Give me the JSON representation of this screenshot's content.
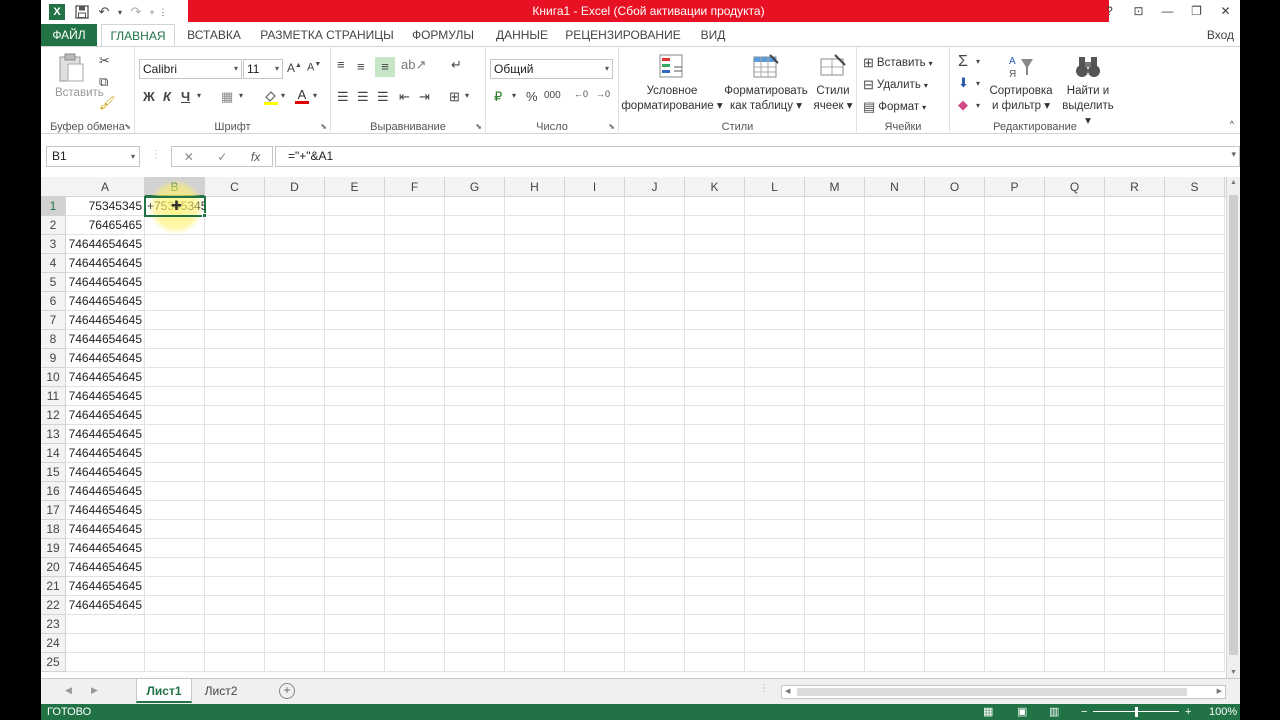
{
  "titlebar": {
    "title": "Книга1 -  Excel (Сбой активации продукта)",
    "help": "?",
    "ribbon_display": "⊡",
    "minimize": "—",
    "restore": "❐",
    "close": "✕"
  },
  "tabs": [
    {
      "label": "ФАЙЛ"
    },
    {
      "label": "ГЛАВНАЯ"
    },
    {
      "label": "ВСТАВКА"
    },
    {
      "label": "РАЗМЕТКА СТРАНИЦЫ"
    },
    {
      "label": "ФОРМУЛЫ"
    },
    {
      "label": "ДАННЫЕ"
    },
    {
      "label": "РЕЦЕНЗИРОВАНИЕ"
    },
    {
      "label": "ВИД"
    }
  ],
  "signin": "Вход",
  "ribbon": {
    "clipboard": {
      "label": "Буфер обмена",
      "paste": "Вставить"
    },
    "font": {
      "label": "Шрифт",
      "name": "Calibri",
      "size": "11",
      "bold": "Ж",
      "italic": "К",
      "underline": "Ч"
    },
    "alignment": {
      "label": "Выравнивание"
    },
    "number": {
      "label": "Число",
      "format": "Общий",
      "percent": "%",
      "thousands": "000"
    },
    "styles": {
      "label": "Стили",
      "conditional_1": "Условное",
      "conditional_2": "форматирование",
      "table_1": "Форматировать",
      "table_2": "как таблицу",
      "cell_1": "Стили",
      "cell_2": "ячеек"
    },
    "cells": {
      "label": "Ячейки",
      "insert": "Вставить",
      "delete": "Удалить",
      "format": "Формат"
    },
    "editing": {
      "label": "Редактирование",
      "sort_1": "Сортировка",
      "sort_2": "и фильтр",
      "find_1": "Найти и",
      "find_2": "выделить"
    }
  },
  "formula_bar": {
    "name_box": "B1",
    "formula": "=\"+\"&A1"
  },
  "columns": [
    "A",
    "B",
    "C",
    "D",
    "E",
    "F",
    "G",
    "H",
    "I",
    "J",
    "K",
    "L",
    "M",
    "N",
    "O",
    "P",
    "Q",
    "R",
    "S"
  ],
  "rows": [
    "1",
    "2",
    "3",
    "4",
    "5",
    "6",
    "7",
    "8",
    "9",
    "10",
    "11",
    "12",
    "13",
    "14",
    "15",
    "16",
    "17",
    "18",
    "19",
    "20",
    "21",
    "22",
    "23",
    "24",
    "25"
  ],
  "cells_a": [
    "75345345",
    "76465465",
    "74644654645",
    "74644654645",
    "74644654645",
    "74644654645",
    "74644654645",
    "74644654645",
    "74644654645",
    "74644654645",
    "74644654645",
    "74644654645",
    "74644654645",
    "74644654645",
    "74644654645",
    "74644654645",
    "74644654645",
    "74644654645",
    "74644654645",
    "74644654645",
    "74644654645",
    "74644654645",
    "",
    "",
    ""
  ],
  "cell_b1": "+75345345",
  "sheets": [
    {
      "label": "Лист1"
    },
    {
      "label": "Лист2"
    }
  ],
  "status": "ГОТОВО",
  "zoom": "100%"
}
